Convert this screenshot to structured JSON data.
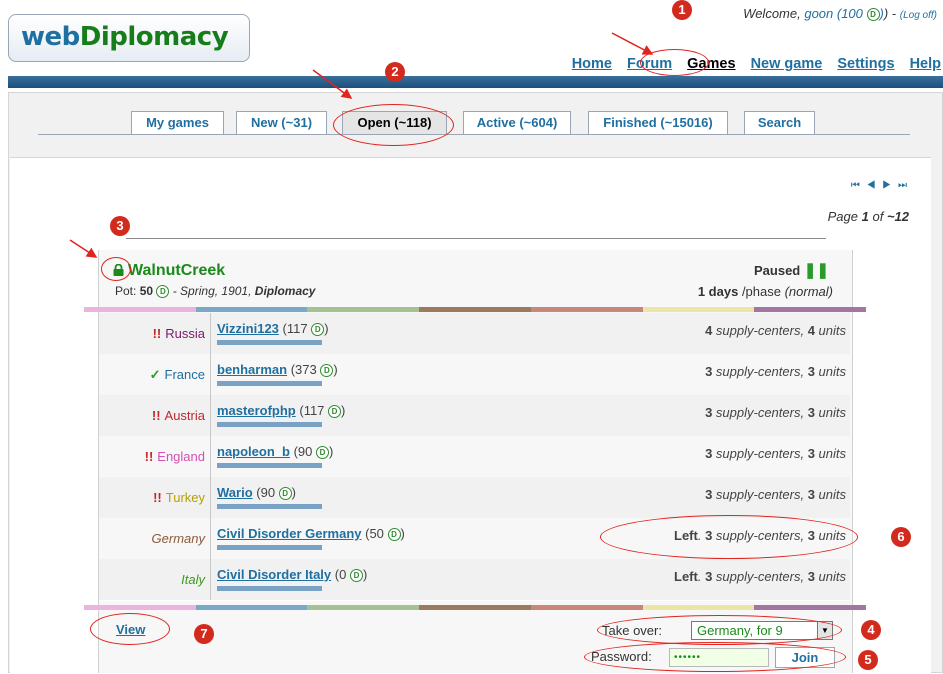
{
  "header": {
    "logo_web": "web",
    "logo_diplomacy": "Diplomacy",
    "welcome_prefix": "Welcome, ",
    "username": "goon (100 ",
    "welcome_close": ") - ",
    "logoff_label": "(Log off)",
    "nav": [
      "Home",
      "Forum",
      "Games",
      "New game",
      "Settings",
      "Help"
    ],
    "current_nav": "Games"
  },
  "coin_glyph": "D",
  "tabs": [
    "My games",
    "New (~31)",
    "Open (~118)",
    "Active (~604)",
    "Finished (~15016)",
    "Search"
  ],
  "selected_tab": "Open (~118)",
  "pagination": {
    "nav_icons": [
      "first-page-icon",
      "prev-page-icon",
      "next-page-icon",
      "last-page-icon"
    ],
    "page_word": "Page ",
    "current": "1",
    "of_word": " of ",
    "total": "~12"
  },
  "game": {
    "name": "WalnutCreek",
    "pot_label": "Pot: ",
    "pot_value": "50",
    "season": " - Spring, 1901, ",
    "variant": "Diplomacy",
    "status": "Paused",
    "phase_length": "1 days",
    "phase_suffix": " /phase ",
    "phase_mode": "(normal)",
    "locked_icon": "lock-icon",
    "paused_icon": "pause-icon"
  },
  "players": [
    {
      "country": "Russia",
      "status": "!!",
      "player": "Vizzini123",
      "points": "(117 ",
      "left": "",
      "sc": "4",
      "units": "4",
      "country_color": "#7a1a6e"
    },
    {
      "country": "France",
      "status": "✓",
      "player": "benharman",
      "points": "(373 ",
      "left": "",
      "sc": "3",
      "units": "3",
      "country_color": "#1f6fa0"
    },
    {
      "country": "Austria",
      "status": "!!",
      "player": "masterofphp",
      "points": "(117 ",
      "left": "",
      "sc": "3",
      "units": "3",
      "country_color": "#c0282b"
    },
    {
      "country": "England",
      "status": "!!",
      "player": "napoleon_b",
      "points": "(90 ",
      "left": "",
      "sc": "3",
      "units": "3",
      "country_color": "#d64fb4"
    },
    {
      "country": "Turkey",
      "status": "!!",
      "player": "Wario",
      "points": "(90 ",
      "left": "",
      "sc": "3",
      "units": "3",
      "country_color": "#b7a100"
    },
    {
      "country": "Germany",
      "status": "",
      "player": "Civil Disorder Germany",
      "points": "(50 ",
      "left": "Left",
      "sc": "3",
      "units": "3",
      "country_color": "#8a5a3a"
    },
    {
      "country": "Italy",
      "status": "",
      "player": "Civil Disorder Italy",
      "points": "(0 ",
      "left": "Left",
      "sc": "3",
      "units": "3",
      "country_color": "#3c9a1a"
    }
  ],
  "sc_label": " supply-centers, ",
  "units_label": " units",
  "points_close": ")",
  "left_sep": ". ",
  "stripe_colors": [
    "#e9b4dd",
    "#79a8c9",
    "#a3c193",
    "#9b7b5e",
    "#c7887b",
    "#ece6a6",
    "#a276a0"
  ],
  "view_label": "View",
  "takeover": {
    "label": "Take over:",
    "selected": "Germany, for 9"
  },
  "password": {
    "label": "Password:",
    "value": "••••••"
  },
  "join_label": "Join",
  "annotations": [
    "1",
    "2",
    "3",
    "4",
    "5",
    "6",
    "7"
  ],
  "accent_color": "#e0241f"
}
